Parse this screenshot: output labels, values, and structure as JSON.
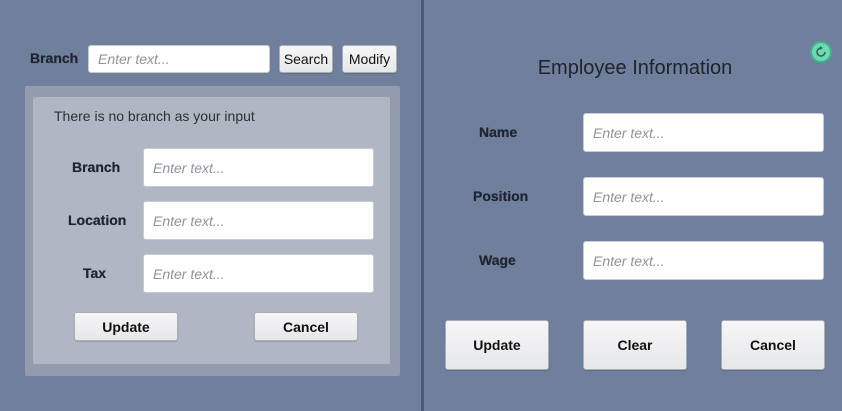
{
  "left": {
    "branch_label": "Branch",
    "branch_search_placeholder": "Enter text...",
    "search_label": "Search",
    "modify_label": "Modify",
    "message": "There is no branch as your input",
    "form": {
      "branch_label": "Branch",
      "branch_placeholder": "Enter text...",
      "location_label": "Location",
      "location_placeholder": "Enter text...",
      "tax_label": "Tax",
      "tax_placeholder": "Enter text...",
      "update_label": "Update",
      "cancel_label": "Cancel"
    }
  },
  "right": {
    "title": "Employee Information",
    "name_label": "Name",
    "name_placeholder": "Enter text...",
    "position_label": "Position",
    "position_placeholder": "Enter text...",
    "wage_label": "Wage",
    "wage_placeholder": "Enter text...",
    "update_label": "Update",
    "clear_label": "Clear",
    "cancel_label": "Cancel",
    "refresh_icon": "refresh-icon"
  },
  "colors": {
    "background": "#6f7f9c",
    "divider": "#4a5a78",
    "outer_panel": "#929cae",
    "inner_panel": "#b1b7c2",
    "refresh_accent": "#6fd8b4"
  }
}
